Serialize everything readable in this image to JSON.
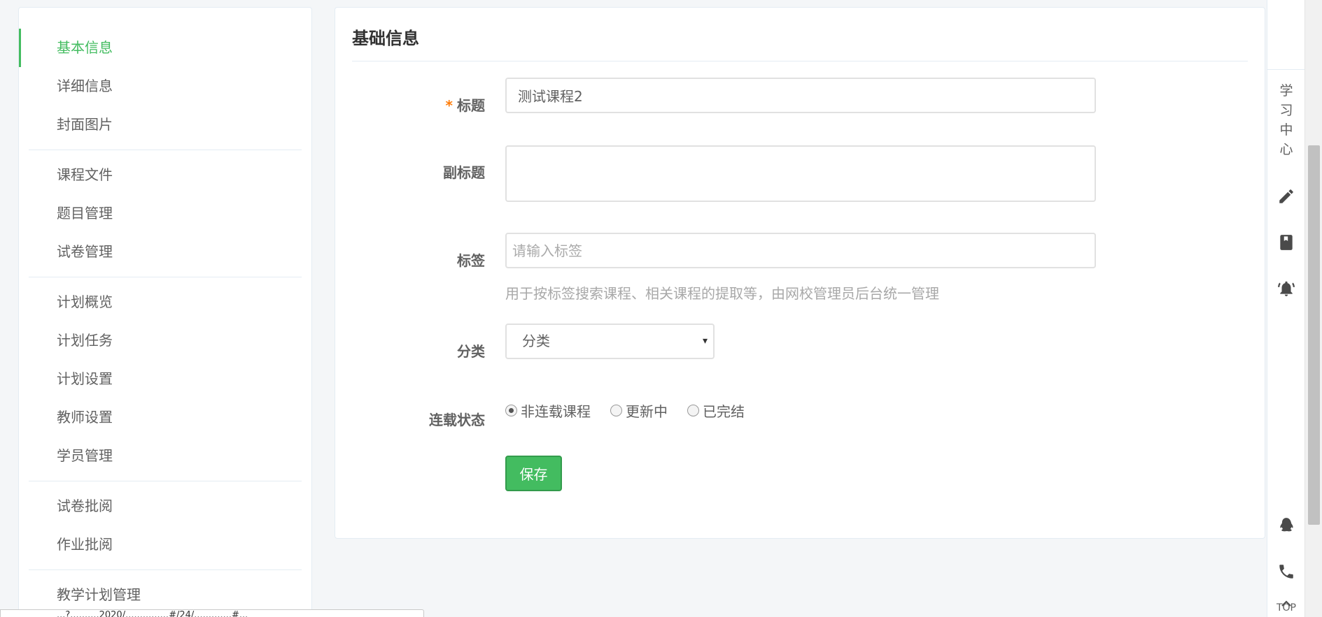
{
  "sidebar": {
    "groups": [
      {
        "items": [
          {
            "label": "基本信息",
            "active": true
          },
          {
            "label": "详细信息"
          },
          {
            "label": "封面图片"
          }
        ]
      },
      {
        "items": [
          {
            "label": "课程文件"
          },
          {
            "label": "题目管理"
          },
          {
            "label": "试卷管理"
          }
        ]
      },
      {
        "items": [
          {
            "label": "计划概览"
          },
          {
            "label": "计划任务"
          },
          {
            "label": "计划设置"
          },
          {
            "label": "教师设置"
          },
          {
            "label": "学员管理"
          }
        ]
      },
      {
        "items": [
          {
            "label": "试卷批阅"
          },
          {
            "label": "作业批阅"
          }
        ]
      },
      {
        "items": [
          {
            "label": "教学计划管理"
          }
        ]
      }
    ]
  },
  "panel": {
    "title": "基础信息",
    "fields": {
      "title": {
        "required_mark": "*",
        "label": "标题",
        "value": "测试课程2"
      },
      "subtitle": {
        "label": "副标题",
        "value": ""
      },
      "tags": {
        "label": "标签",
        "placeholder": "请输入标签",
        "help": "用于按标签搜索课程、相关课程的提取等，由网校管理员后台统一管理"
      },
      "category": {
        "label": "分类",
        "selected": "分类",
        "caret": "▾"
      },
      "serialize": {
        "label": "连载状态",
        "options": [
          {
            "label": "非连载课程",
            "checked": true
          },
          {
            "label": "更新中",
            "checked": false
          },
          {
            "label": "已完结",
            "checked": false
          }
        ]
      }
    },
    "save_label": "保存"
  },
  "toolbar": {
    "study_center": "学\n习\n中\n心",
    "top_label": "TOP",
    "icons": [
      "pencil-icon",
      "book-icon",
      "bell-icon",
      "qq-icon",
      "phone-icon",
      "arrow-up-icon"
    ]
  },
  "status_bar": {
    "text": "...?..........2020/...............#/24/.............#..."
  },
  "colors": {
    "accent": "#43bc60",
    "required": "#ff7d0a",
    "text": "#616161",
    "muted": "#a8a8a8"
  }
}
